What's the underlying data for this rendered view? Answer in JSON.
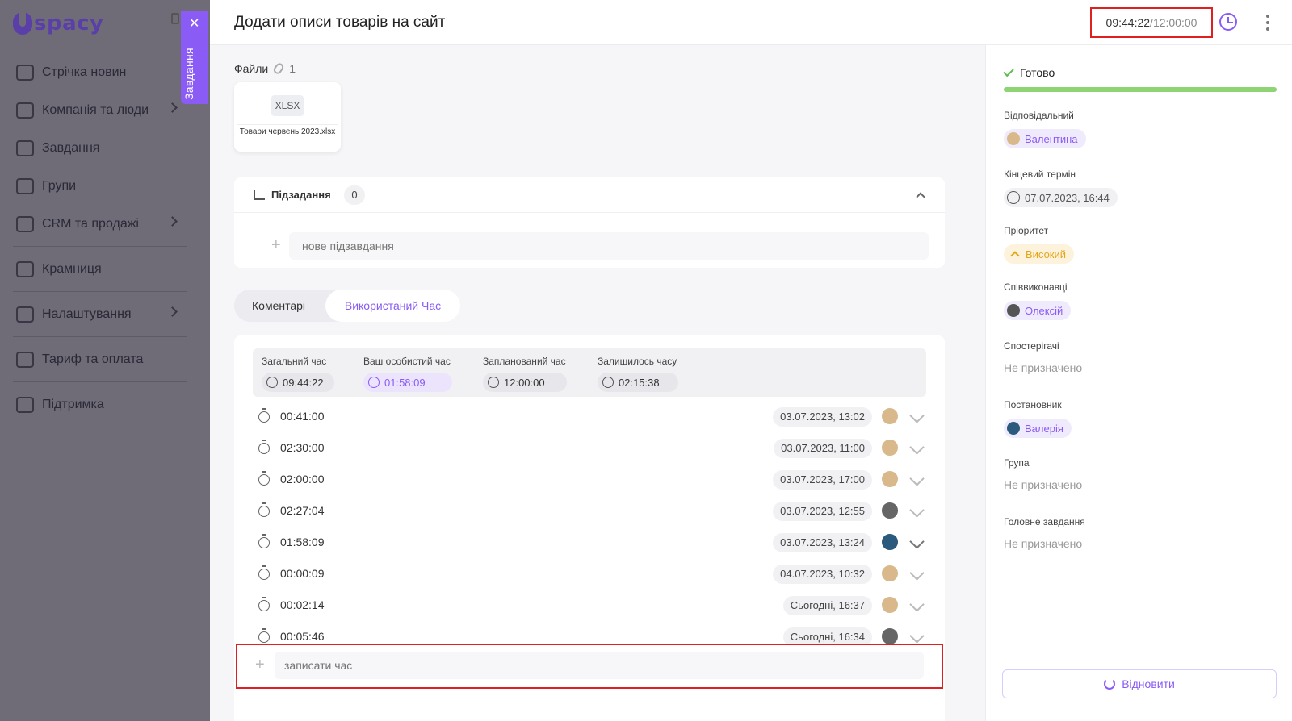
{
  "app": {
    "logo_text": "spacy"
  },
  "sidebar": {
    "items": [
      {
        "label": "Стрічка новин"
      },
      {
        "label": "Компанія та люди"
      },
      {
        "label": "Завдання"
      },
      {
        "label": "Групи"
      },
      {
        "label": "CRM та продажі"
      },
      {
        "label": "Крамниця"
      },
      {
        "label": "Налаштування"
      },
      {
        "label": "Тариф та оплата"
      },
      {
        "label": "Підтримка"
      }
    ],
    "tasks_tab_label": "Завдання"
  },
  "task": {
    "title": "Додати описи товарів на сайт",
    "timer_spent": "09:44:22",
    "timer_planned": "12:00:00"
  },
  "files": {
    "label": "Файли",
    "count": "1",
    "items": [
      {
        "ext": "XLSX",
        "name": "Товари червень 2023.xlsx"
      }
    ]
  },
  "subtasks": {
    "title": "Підзадання",
    "count": "0",
    "new_placeholder": "нове підзавдання"
  },
  "tabs": {
    "comments": "Коментарі",
    "time_used": "Використаний Час"
  },
  "time_stats": {
    "total": {
      "label": "Загальний час",
      "value": "09:44:22"
    },
    "personal": {
      "label": "Ваш особистий час",
      "value": "01:58:09"
    },
    "planned": {
      "label": "Запланований час",
      "value": "12:00:00"
    },
    "remaining": {
      "label": "Залишилось часу",
      "value": "02:15:38"
    }
  },
  "time_entries": [
    {
      "duration": "00:41:00",
      "date": "03.07.2023, 13:02"
    },
    {
      "duration": "02:30:00",
      "date": "03.07.2023, 11:00"
    },
    {
      "duration": "02:00:00",
      "date": "03.07.2023, 17:00"
    },
    {
      "duration": "02:27:04",
      "date": "03.07.2023, 12:55"
    },
    {
      "duration": "01:58:09",
      "date": "03.07.2023, 13:24"
    },
    {
      "duration": "00:00:09",
      "date": "04.07.2023, 10:32"
    },
    {
      "duration": "00:02:14",
      "date": "Сьогодні, 16:37"
    },
    {
      "duration": "00:05:46",
      "date": "Сьогодні, 16:34"
    }
  ],
  "log_time_placeholder": "записати час",
  "details": {
    "status": "Готово",
    "progress": 1.0,
    "responsible": {
      "label": "Відповідальний",
      "value": "Валентина"
    },
    "deadline": {
      "label": "Кінцевий термін",
      "value": "07.07.2023, 16:44"
    },
    "priority": {
      "label": "Пріоритет",
      "value": "Високий"
    },
    "coexecutors": {
      "label": "Співвиконавці",
      "value": "Олексій"
    },
    "observers": {
      "label": "Спостерігачі",
      "value": "Не призначено"
    },
    "assigner": {
      "label": "Постановник",
      "value": "Валерія"
    },
    "group": {
      "label": "Група",
      "value": "Не призначено"
    },
    "parent_task": {
      "label": "Головне завдання",
      "value": "Не призначено"
    },
    "restore_button": "Відновити"
  },
  "colors": {
    "accent": "#8a5cf5",
    "success": "#8fd474",
    "highlight": "#e02020",
    "priority": "#e5a51b"
  }
}
